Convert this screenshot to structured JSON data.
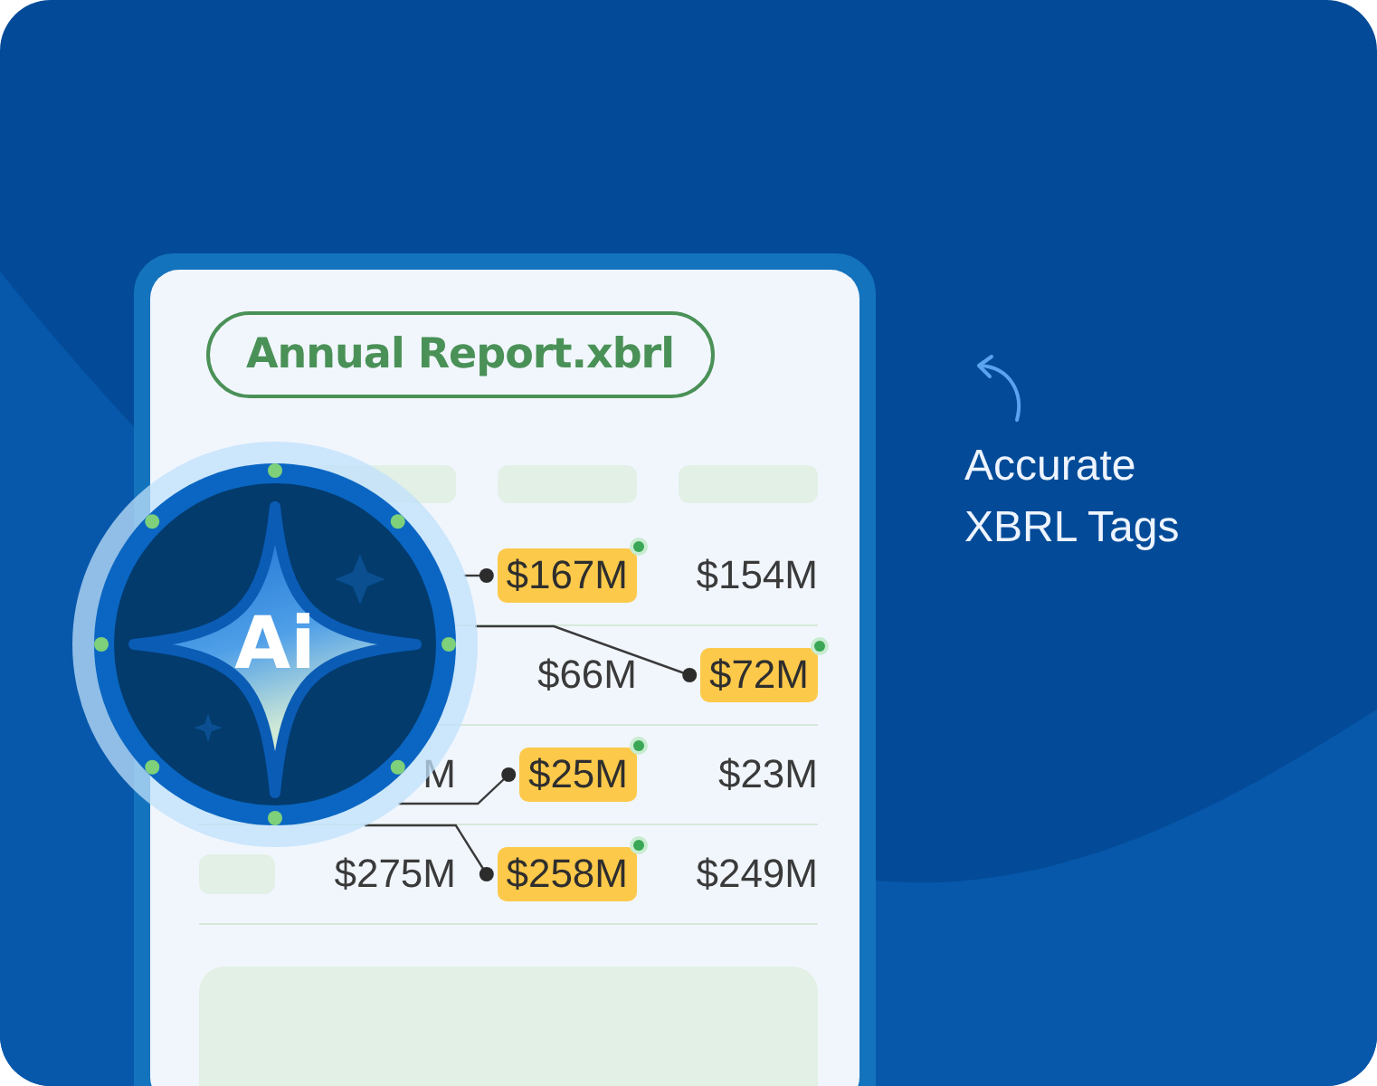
{
  "document": {
    "filename": "Annual Report.xbrl",
    "rows": [
      {
        "label_bar": false,
        "cells": [
          {
            "kind": "blank"
          },
          {
            "kind": "tag",
            "text": "$167M"
          },
          {
            "kind": "value",
            "text": "$154M"
          }
        ]
      },
      {
        "label_bar": false,
        "cells": [
          {
            "kind": "blank"
          },
          {
            "kind": "value",
            "text": "$66M"
          },
          {
            "kind": "tag",
            "text": "$72M"
          }
        ]
      },
      {
        "label_bar": false,
        "cells": [
          {
            "kind": "value",
            "text": "M"
          },
          {
            "kind": "tag",
            "text": "$25M"
          },
          {
            "kind": "value",
            "text": "$23M"
          }
        ]
      },
      {
        "label_bar": true,
        "cells": [
          {
            "kind": "value",
            "text": "$275M"
          },
          {
            "kind": "tag",
            "text": "$258M"
          },
          {
            "kind": "value",
            "text": "$249M"
          }
        ]
      }
    ]
  },
  "badge": {
    "text": "Ai"
  },
  "caption": "Accurate XBRL Tags"
}
